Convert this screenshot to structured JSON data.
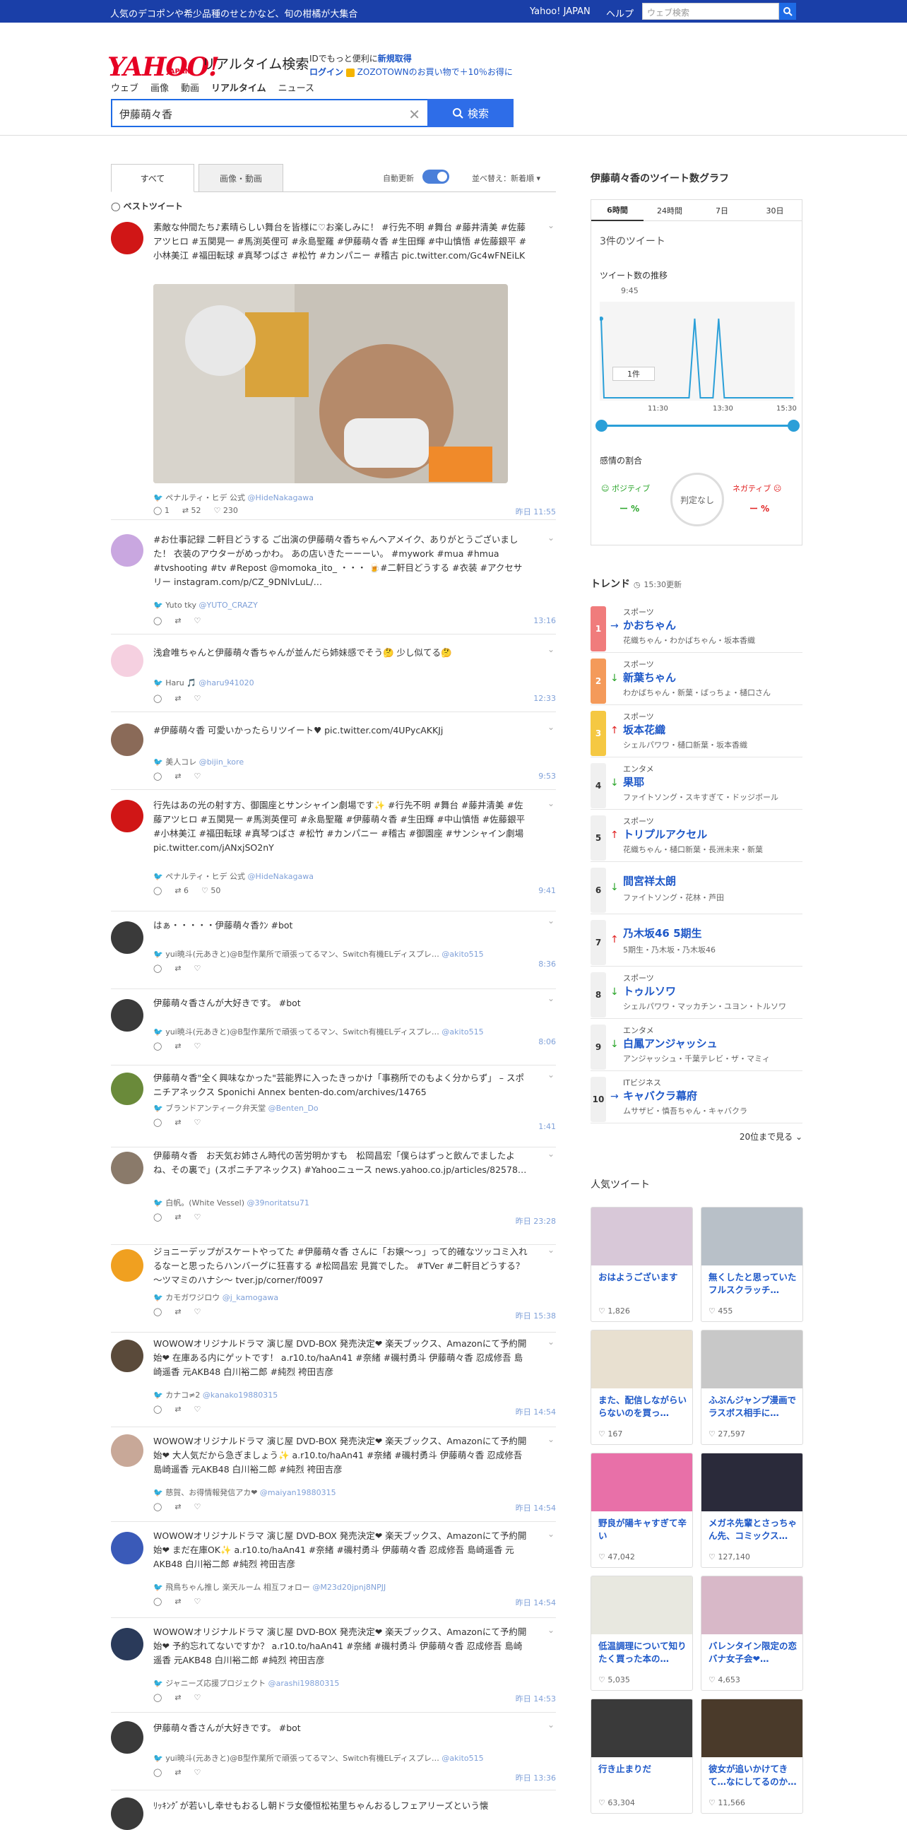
{
  "topbar": {
    "promo": "人気のデコポンや希少品種のせとかなど、旬の柑橘が大集合",
    "links": [
      "Yahoo! JAPAN",
      "ヘルプ"
    ],
    "search_placeholder": "ウェブ検索"
  },
  "header": {
    "logo": "YAHOO!",
    "logo_sub": "JAPAN",
    "site_name": "リアルタイム検索",
    "id_line1_a": "IDでもっと便利に",
    "id_line1_b": "新規取得",
    "id_line2_a": "ログイン",
    "id_line2_b": "ZOZOTOWNのお買い物で＋10％お得に"
  },
  "nav": [
    "ウェブ",
    "画像",
    "動画",
    "リアルタイム",
    "ニュース"
  ],
  "search": {
    "query": "伊藤萌々香",
    "button": "検索"
  },
  "tabs": {
    "all": "すべて",
    "media": "画像・動画",
    "auto_update": "自動更新",
    "sort": "並べ替え：新着順"
  },
  "best_label": "ベストツイート",
  "tweets": [
    {
      "body": "素敵な仲間たち♪素晴らしい舞台を皆様に♡お楽しみに！ #行先不明 #舞台 #藤井清美 #佐藤アツヒロ #五関晃一 #馬渕英俚可 #永島聖羅 #伊藤萌々香 #生田輝 #中山慎悟 #佐藤銀平 #小林美江 #福田転球 #真琴つばさ #松竹 #カンパニー #稽古 pic.twitter.com/Gc4wFNEiLK",
      "user": "ペナルティ・ヒデ 公式",
      "handle": "@HideNakagawa",
      "replies": "1",
      "rts": "52",
      "likes": "230",
      "time": "昨日 11:55"
    },
    {
      "body": "#お仕事記録 二軒目どうする ご出演の伊藤萌々香ちゃんヘアメイク、ありがとうございました！ 衣装のアウターがめっかわ。 あの店いきたーーーい。 #mywork #mua #hmua #tvshooting #tv #Repost @momoka_ito_ ・・・ 🍺#二軒目どうする #衣装 #アクセサリー instagram.com/p/CZ_9DNlvLuL/…",
      "user": "Yuto tky",
      "handle": "@YUTO_CRAZY",
      "time": "13:16"
    },
    {
      "body": "浅倉唯ちゃんと伊藤萌々香ちゃんが並んだら姉妹感でそう🤔 少し似てる🤔",
      "user": "Haru 🎵",
      "handle": "@haru941020",
      "time": "12:33"
    },
    {
      "body": "#伊藤萌々香 可愛いかったらリツイート♥ pic.twitter.com/4UPycAKKJj",
      "user": "美人コレ",
      "handle": "@bijin_kore",
      "time": "9:53"
    },
    {
      "body": "行先はあの光の射す方、御園座とサンシャイン劇場です✨ #行先不明 #舞台 #藤井清美 #佐藤アツヒロ #五関晃一 #馬渕英俚可 #永島聖羅 #伊藤萌々香 #生田輝 #中山慎悟 #佐藤銀平 #小林美江 #福田転球 #真琴つばさ #松竹 #カンパニー #稽古 #御園座 #サンシャイン劇場 pic.twitter.com/jANxjSO2nY",
      "user": "ペナルティ・ヒデ 公式",
      "handle": "@HideNakagawa",
      "rts": "6",
      "likes": "50",
      "time": "9:41"
    },
    {
      "body": "はぁ・・・・・伊藤萌々香ｸﾝ #bot",
      "user": "yui暁斗(元あきと)@B型作業所で頑張ってるマン、Switch有機ELディスプレ…",
      "handle": "@akito515",
      "time": "8:36"
    },
    {
      "body": "伊藤萌々香さんが大好きです。 #bot",
      "user": "yui暁斗(元あきと)@B型作業所で頑張ってるマン、Switch有機ELディスプレ…",
      "handle": "@akito515",
      "time": "8:06"
    },
    {
      "body": "伊藤萌々香\"全く興味なかった\"芸能界に入ったきっかけ「事務所でのもよく分からず」 – スポニチアネックス Sponichi Annex benten-do.com/archives/14765",
      "user": "ブランドアンティーク弁天堂",
      "handle": "@Benten_Do",
      "time": "1:41"
    },
    {
      "body": "伊藤萌々香　お天気お姉さん時代の苦労明かすも　松岡昌宏「僕らはずっと飲んでましたよね、その裏で」(スポニチアネックス) #Yahooニュース news.yahoo.co.jp/articles/82578…",
      "user": "白帆。(White Vessel)",
      "handle": "@39noritatsu71",
      "time": "昨日 23:28"
    },
    {
      "body": "ジョニーデップがスケートやってた #伊藤萌々香 さんに「お嬢〜っ」って的確なツッコミ入れるなーと思ったらハンバーグに狂喜する #松岡昌宏 見賞でした。 #TVer #二軒目どうする？～ツマミのハナシ～ tver.jp/corner/f0097",
      "user": "カモガワジロウ",
      "handle": "@j_kamogawa",
      "time": "昨日 15:38"
    },
    {
      "body": "WOWOWオリジナルドラマ 演じ屋 DVD-BOX 発売決定❤ 楽天ブックス、Amazonにて予約開始❤ 在庫ある内にゲットです！ a.r10.to/haAn41 #奈緒 #磯村勇斗 伊藤萌々香 忍成修吾 島崎遥香 元AKB48 白川裕二郎 #純烈 袴田吉彦",
      "user": "カナコ≠2",
      "handle": "@kanako19880315",
      "time": "昨日 14:54"
    },
    {
      "body": "WOWOWオリジナルドラマ 演じ屋 DVD-BOX 発売決定❤ 楽天ブックス、Amazonにて予約開始❤ 大人気だから急ぎましょう✨ a.r10.to/haAn41 #奈緒 #磯村勇斗 伊藤萌々香 忍成修吾 島崎遥香 元AKB48 白川裕二郎 #純烈 袴田吉彦",
      "user": "慈賀、お得情報発信アカ❤",
      "handle": "@maiyan19880315",
      "time": "昨日 14:54"
    },
    {
      "body": "WOWOWオリジナルドラマ 演じ屋 DVD-BOX 発売決定❤ 楽天ブックス、Amazonにて予約開始❤ まだ在庫OK✨ a.r10.to/haAn41 #奈緒 #磯村勇斗 伊藤萌々香 忍成修吾 島崎遥香 元AKB48 白川裕二郎 #純烈 袴田吉彦",
      "user": "飛鳥ちゃん推し 楽天ルーム 相互フォロー",
      "handle": "@M23d20jpnj8NPJJ",
      "time": "昨日 14:54"
    },
    {
      "body": "WOWOWオリジナルドラマ 演じ屋 DVD-BOX 発売決定❤ 楽天ブックス、Amazonにて予約開始❤ 予約忘れてないですか？ a.r10.to/haAn41 #奈緒 #磯村勇斗 伊藤萌々香 忍成修吾 島崎遥香 元AKB48 白川裕二郎 #純烈 袴田吉彦",
      "user": "ジャニーズ応援プロジェクト",
      "handle": "@arashi19880315",
      "time": "昨日 14:53"
    },
    {
      "body": "伊藤萌々香さんが大好きです。 #bot",
      "user": "yui暁斗(元あきと)@B型作業所で頑張ってるマン、Switch有機ELディスプレ…",
      "handle": "@akito515",
      "time": "昨日 13:36"
    },
    {
      "body": "ﾘｯｷﾝｸﾞが若いし幸せもおるし朝ドラ女優恒松祐里ちゃんおるしフェアリーズという懐",
      "user": "",
      "handle": "",
      "time": ""
    }
  ],
  "graph": {
    "title": "伊藤萌々香のツイート数グラフ",
    "ranges": [
      "6時間",
      "24時間",
      "7日",
      "30日"
    ],
    "count_label": "3件のツイート",
    "trend_label": "ツイート数の推移",
    "start_time": "9:45",
    "ticks": [
      "11:30",
      "13:30",
      "15:30"
    ],
    "tooltip": "1件",
    "sentiment_label": "感情の割合",
    "positive": "ポジティブ",
    "negative": "ネガティブ",
    "pos_value": "ー %",
    "neg_value": "ー %",
    "neutral": "判定なし"
  },
  "graph_chart": {
    "type": "line",
    "x": [
      "9:45",
      "11:30",
      "13:30",
      "15:30"
    ],
    "peaks": [
      {
        "t": "9:45",
        "v": 1
      },
      {
        "t": "12:33",
        "v": 1
      },
      {
        "t": "13:16",
        "v": 1
      }
    ]
  },
  "trend": {
    "title": "トレンド",
    "updated": "15:30更新",
    "more": "20位まで見る",
    "items": [
      {
        "rank": "1",
        "cat": "スポーツ",
        "word": "かおちゃん",
        "rel": "花織ちゃん・わかばちゃん・坂本香織",
        "arrow": "→",
        "color": "#f07c7c"
      },
      {
        "rank": "2",
        "cat": "スポーツ",
        "word": "新葉ちゃん",
        "rel": "わかばちゃん・新葉・ばっちょ・樋口さん",
        "arrow": "↓",
        "color": "#f49a5a"
      },
      {
        "rank": "3",
        "cat": "スポーツ",
        "word": "坂本花織",
        "rel": "シェルパワワ・樋口新葉・坂本香織",
        "arrow": "↑",
        "color": "#f5c842"
      },
      {
        "rank": "4",
        "cat": "エンタメ",
        "word": "果耶",
        "rel": "ファイトソング・スキすぎて・ドッジボール",
        "arrow": "↓",
        "color": ""
      },
      {
        "rank": "5",
        "cat": "スポーツ",
        "word": "トリプルアクセル",
        "rel": "花織ちゃん・樋口新葉・長洲未来・新葉",
        "arrow": "↑",
        "color": ""
      },
      {
        "rank": "6",
        "cat": "",
        "word": "間宮祥太朗",
        "rel": "ファイトソング・花林・芦田",
        "arrow": "↓",
        "color": ""
      },
      {
        "rank": "7",
        "cat": "",
        "word": "乃木坂46 5期生",
        "rel": "5期生・乃木坂・乃木坂46",
        "arrow": "↑",
        "color": ""
      },
      {
        "rank": "8",
        "cat": "スポーツ",
        "word": "トゥルソワ",
        "rel": "シェルパワワ・マッカチン・ユヨン・トルソワ",
        "arrow": "↓",
        "color": ""
      },
      {
        "rank": "9",
        "cat": "エンタメ",
        "word": "白鳳アンジャッシュ",
        "rel": "アンジャッシュ・千葉テレビ・ザ・マミィ",
        "arrow": "↓",
        "color": ""
      },
      {
        "rank": "10",
        "cat": "ITビジネス",
        "word": "キャバクラ幕府",
        "rel": "ムサザビ・慎吾ちゃん・キャバクラ",
        "arrow": "→",
        "color": ""
      }
    ]
  },
  "popular": {
    "title": "人気ツイート",
    "items": [
      {
        "text": "おはようございます",
        "likes": "1,826"
      },
      {
        "text": "無くしたと思っていたフルスクラッチ…",
        "likes": "455"
      },
      {
        "text": "また、配信しながらいらないのを買っ…",
        "likes": "167"
      },
      {
        "text": "ふぶんジャンプ漫画でラスボス相手に…",
        "likes": "27,597"
      },
      {
        "text": "野良が陽キャすぎて辛い",
        "likes": "47,042"
      },
      {
        "text": "メガネ先輩とさっちゃん先、コミックス…",
        "likes": "127,140"
      },
      {
        "text": "低温調理について知りたく買った本の…",
        "likes": "5,035"
      },
      {
        "text": "バレンタイン限定の恋バナ女子会❤…",
        "likes": "4,653"
      },
      {
        "text": "行き止まりだ",
        "likes": "63,304"
      },
      {
        "text": "彼女が追いかけてきて…なにしてるのか…",
        "likes": "11,566"
      }
    ]
  }
}
